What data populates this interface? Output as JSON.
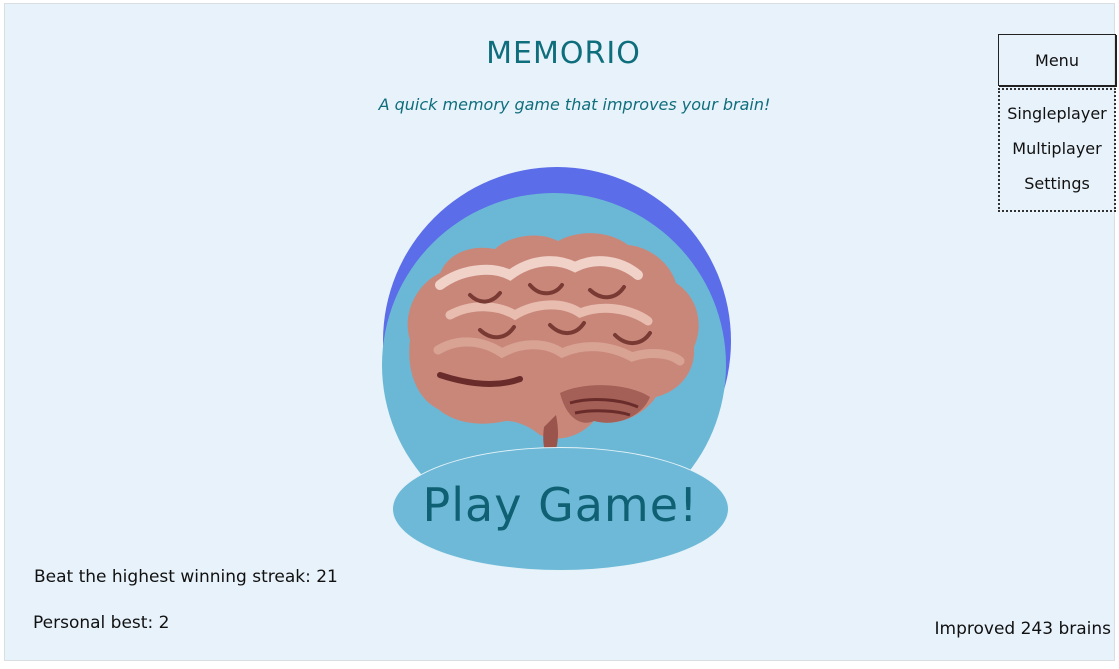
{
  "header": {
    "title": "MEMORIO",
    "subtitle": "A quick memory game that improves your brain!"
  },
  "menu": {
    "button_label": "Menu",
    "items": [
      {
        "label": "Singleplayer"
      },
      {
        "label": "Multiplayer"
      },
      {
        "label": "Settings"
      }
    ]
  },
  "hero": {
    "image": "brain-illustration",
    "play_label": "Play Game!"
  },
  "stats": {
    "streak_text": "Beat the highest winning streak: 21",
    "personal_best_text": "Personal best: 2",
    "improved_text": "Improved 243 brains"
  },
  "colors": {
    "background": "#e8f2fb",
    "accent_text": "#0f6e7c",
    "outer_circle": "#5b6de8",
    "inner_circle": "#6bb8d6",
    "play_button": "#6db9d7"
  }
}
